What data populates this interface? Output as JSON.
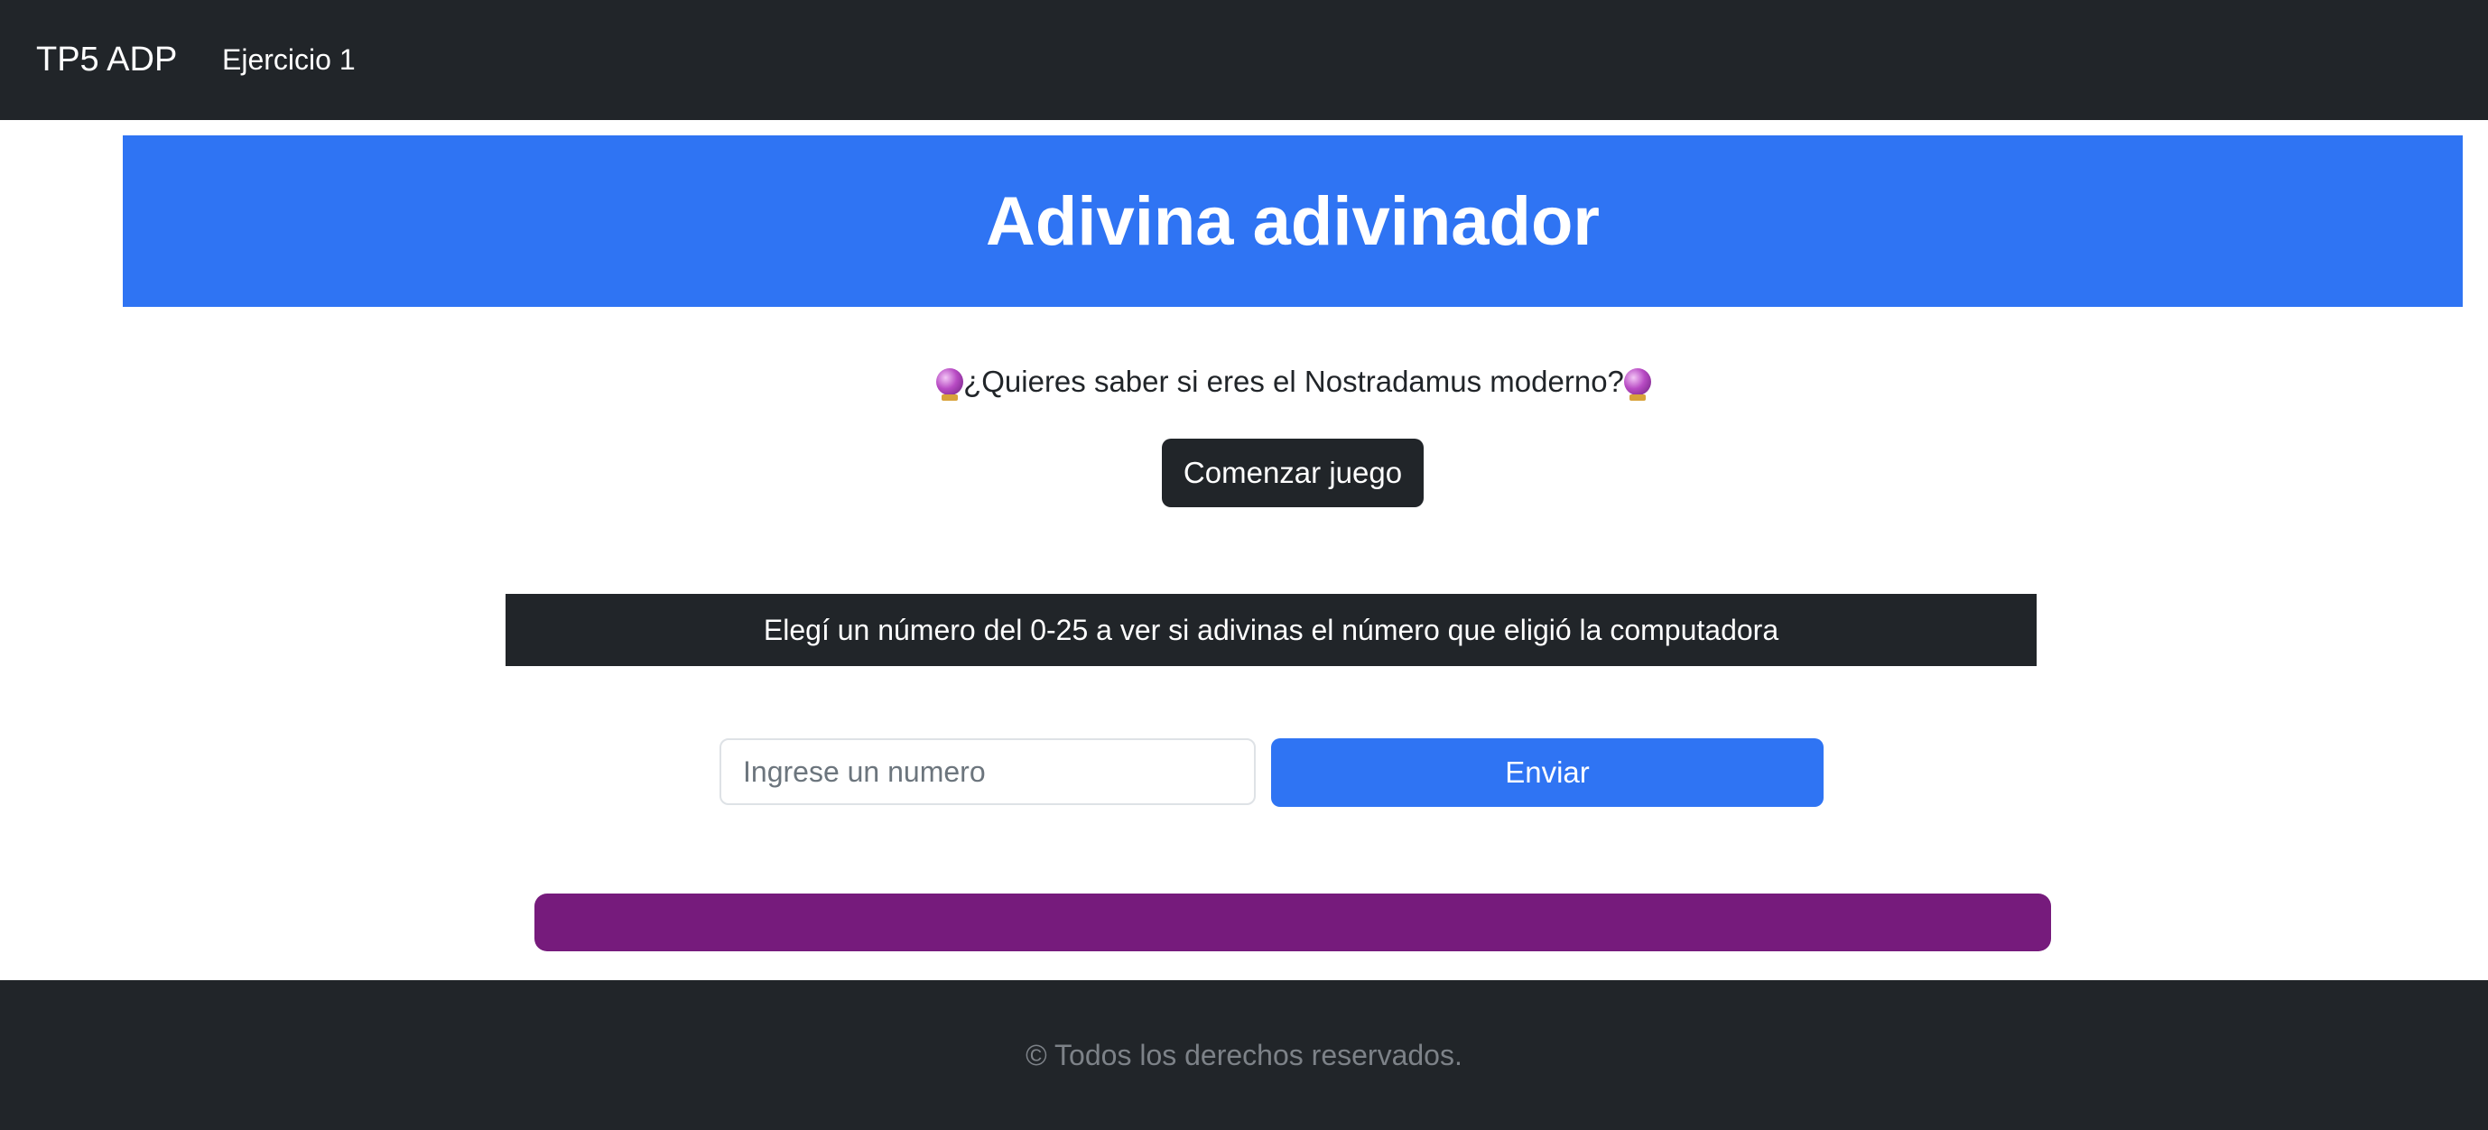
{
  "navbar": {
    "brand": "TP5 ADP",
    "links": [
      {
        "label": "Ejercicio 1"
      }
    ]
  },
  "hero": {
    "title": "Adivina adivinador"
  },
  "intro": {
    "question": "¿Quieres saber si eres el Nostradamus moderno?",
    "start_button": "Comenzar juego"
  },
  "game": {
    "instruction": "Elegí un número del 0-25 a ver si adivinas el número que eligió la computadora",
    "input_value": "",
    "input_placeholder": "Ingrese un numero",
    "send_button": "Enviar"
  },
  "footer": {
    "text": "© Todos los derechos reservados."
  },
  "icons": {
    "crystal_ball": "crystal-ball-icon"
  },
  "colors": {
    "dark": "#212529",
    "primary": "#2f74f3",
    "result": "#761b7c",
    "footer_text": "#7d8288"
  }
}
